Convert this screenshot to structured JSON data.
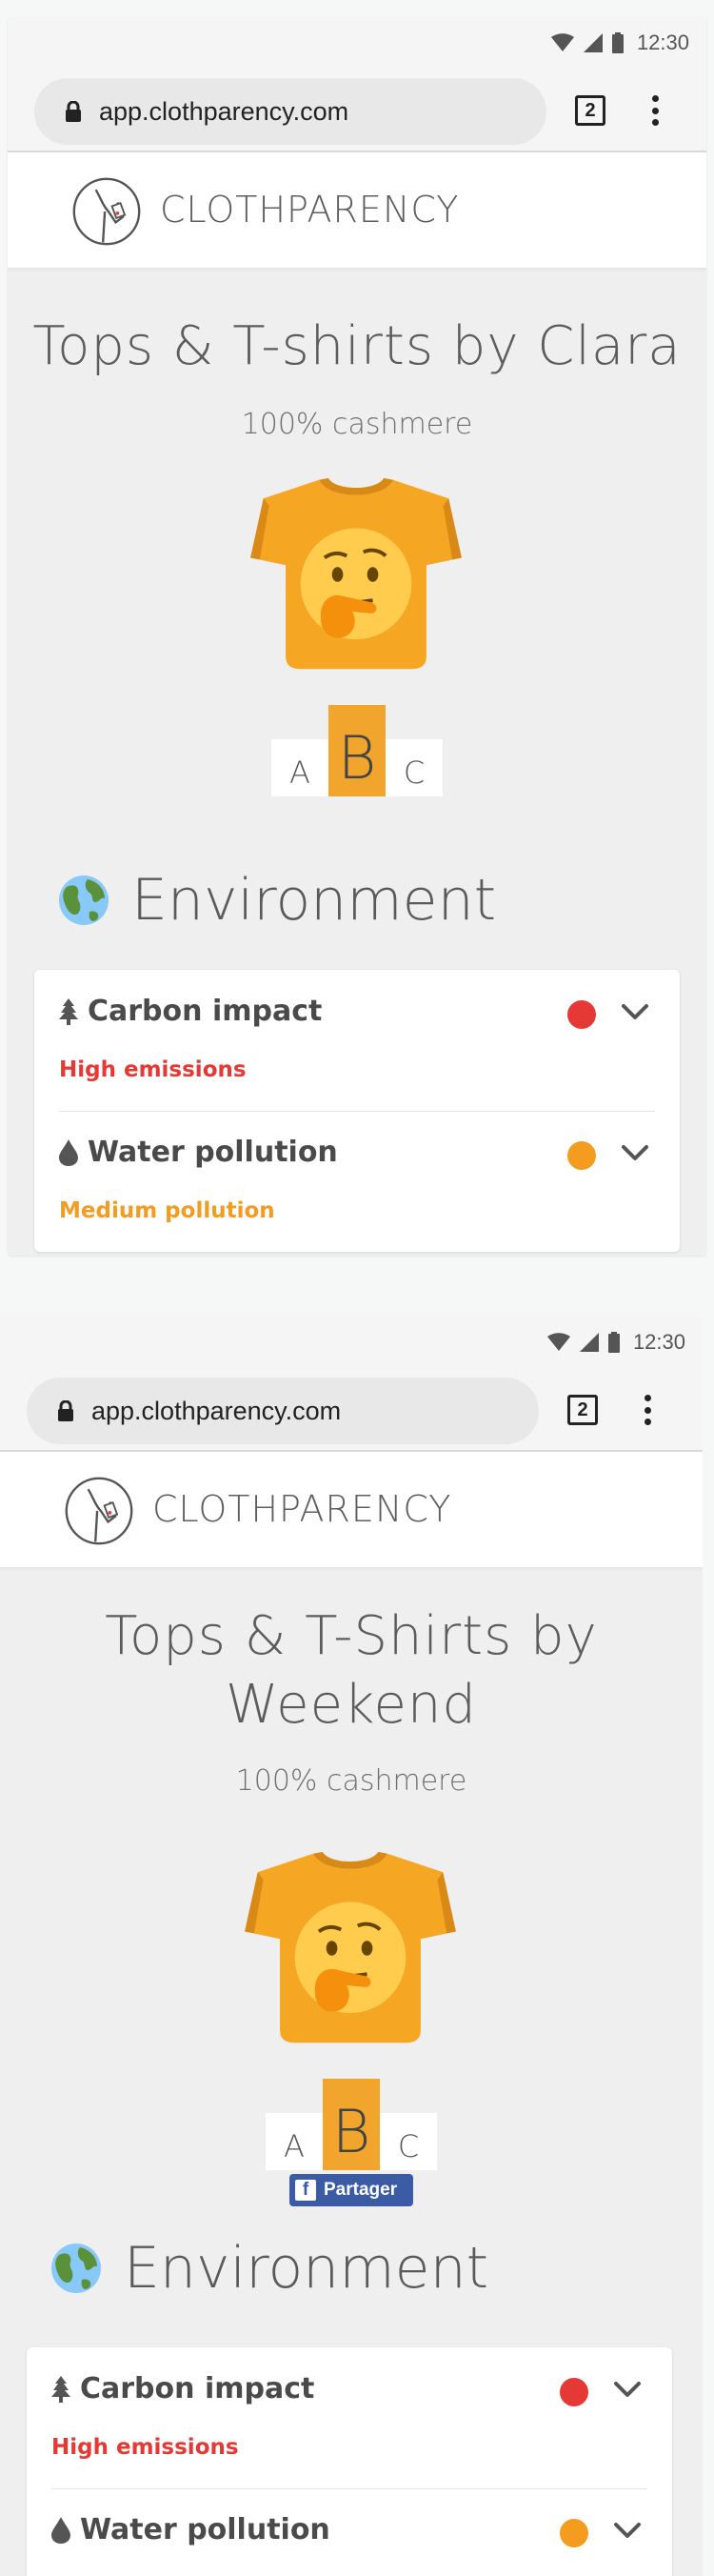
{
  "colors": {
    "accent": "#f2a52c",
    "high": "#e53935",
    "medium": "#f39c1f",
    "facebook": "#3b5ba5"
  },
  "screens": [
    {
      "status": {
        "time": "12:30"
      },
      "browser": {
        "url": "app.clothparency.com",
        "tab_count": "2"
      },
      "header": {
        "brand": "CLOTHPARENCY"
      },
      "product": {
        "title_lines": [
          "Tops & T-shirts by Clara"
        ],
        "material": "100% cashmere",
        "emoji": "thinking-face-icon"
      },
      "grades": [
        "A",
        "B",
        "C"
      ],
      "active_grade": "B",
      "environment": {
        "title": "Environment",
        "rows": [
          {
            "label": "Carbon impact",
            "icon": "tree-icon",
            "status": "High emissions",
            "level": "high"
          },
          {
            "label": "Water pollution",
            "icon": "droplet-icon",
            "status": "Medium pollution",
            "level": "medium"
          }
        ]
      }
    },
    {
      "status": {
        "time": "12:30"
      },
      "browser": {
        "url": "app.clothparency.com",
        "tab_count": "2"
      },
      "header": {
        "brand": "CLOTHPARENCY"
      },
      "product": {
        "title_lines": [
          "Tops & T-Shirts by",
          "Weekend"
        ],
        "material": "100% cashmere",
        "emoji": "thinking-face-icon"
      },
      "grades": [
        "A",
        "B",
        "C"
      ],
      "active_grade": "B",
      "share": {
        "label": "Partager"
      },
      "environment": {
        "title": "Environment",
        "rows": [
          {
            "label": "Carbon impact",
            "icon": "tree-icon",
            "status": "High emissions",
            "level": "high"
          },
          {
            "label": "Water pollution",
            "icon": "droplet-icon",
            "level": "medium"
          }
        ]
      }
    }
  ]
}
